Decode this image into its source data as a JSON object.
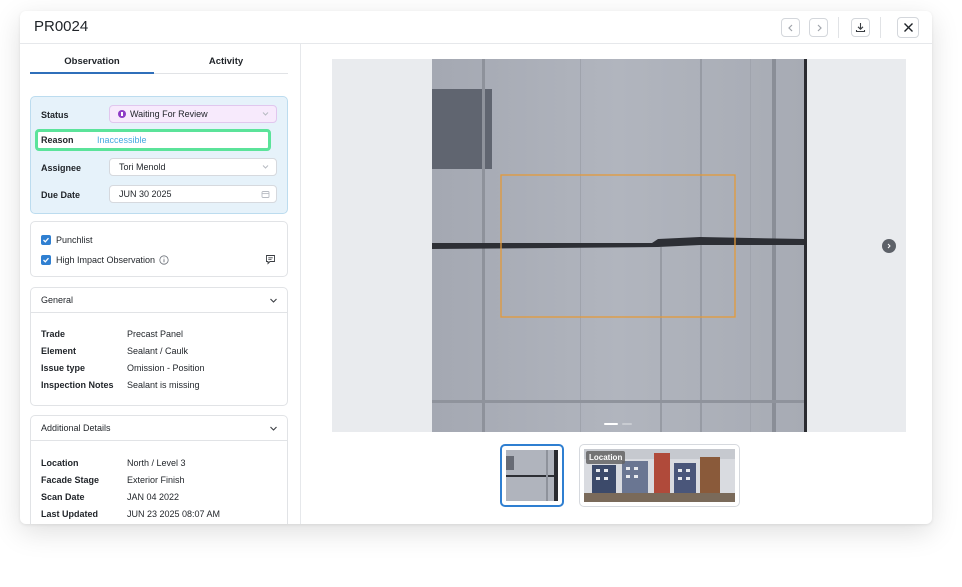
{
  "header": {
    "title": "PR0024",
    "prev_icon": "chevron-left-icon",
    "next_icon": "chevron-right-icon",
    "download_icon": "download-icon",
    "close_icon": "close-icon"
  },
  "tabs": [
    {
      "label": "Observation",
      "active": true
    },
    {
      "label": "Activity",
      "active": false
    }
  ],
  "status_card": {
    "status_label": "Status",
    "status_value": "Waiting For Review",
    "reason_label": "Reason",
    "reason_value": "Inaccessible",
    "assignee_label": "Assignee",
    "assignee_value": "Tori Menold",
    "due_label": "Due Date",
    "due_value": "JUN 30 2025"
  },
  "flags": {
    "punchlist_label": "Punchlist",
    "punchlist_checked": true,
    "high_impact_label": "High Impact Observation",
    "high_impact_checked": true
  },
  "general": {
    "title": "General",
    "rows": [
      {
        "key": "Trade",
        "value": "Precast Panel"
      },
      {
        "key": "Element",
        "value": "Sealant / Caulk"
      },
      {
        "key": "Issue type",
        "value": "Omission - Position"
      },
      {
        "key": "Inspection Notes",
        "value": "Sealant is missing"
      }
    ]
  },
  "additional": {
    "title": "Additional Details",
    "rows": [
      {
        "key": "Location",
        "value": "North / Level 3"
      },
      {
        "key": "Facade Stage",
        "value": "Exterior Finish"
      },
      {
        "key": "Scan Date",
        "value": "JAN 04 2022"
      },
      {
        "key": "Last Updated",
        "value": "JUN 23 2025 08:07 AM"
      }
    ]
  },
  "viewer": {
    "location_badge": "Location"
  },
  "colors": {
    "accent": "#2f7fd1",
    "status_purple": "#8e3bc6",
    "reason_highlight": "#5be39a",
    "annotation_box": "#e39a3a"
  }
}
